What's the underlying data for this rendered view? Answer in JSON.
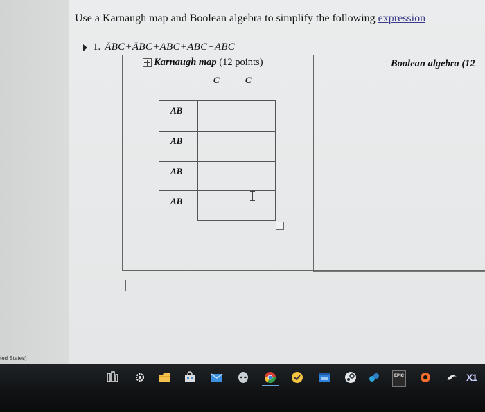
{
  "document": {
    "heading_prefix": "Use a Karnaugh map and Boolean algebra to simplify the following ",
    "heading_link": "expression",
    "question_number": "1.",
    "question_expression": "ĀBC+ĀBC+ABC+ABC+ABC"
  },
  "table": {
    "kmap_title": "Karnaugh map",
    "kmap_points": "(12 points)",
    "boolean_title": "Boolean algebra",
    "boolean_points": "(12",
    "col_headers": [
      "C",
      "C"
    ],
    "row_labels": [
      "AB",
      "AB",
      "AB",
      "AB"
    ]
  },
  "status": {
    "region_text": "ted States)"
  },
  "taskbar": {
    "icons": [
      "task-view-icon",
      "settings-icon",
      "file-explorer-icon",
      "store-icon",
      "mail-icon",
      "alienware-icon",
      "chrome-icon",
      "check-app-icon",
      "calendar-icon",
      "steam-icon",
      "app-icon",
      "epic-games-icon",
      "origin-icon",
      "uplay-icon",
      "xbox-icon"
    ],
    "epic_label": "EPIC",
    "x1_label": "X1"
  }
}
